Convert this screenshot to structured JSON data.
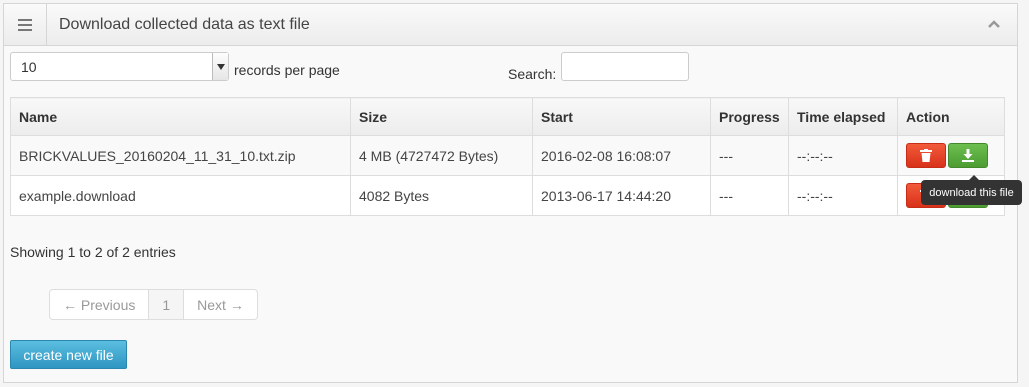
{
  "widget": {
    "title": "Download collected data as text file"
  },
  "controls": {
    "length_value": "10",
    "records_label": "records per page",
    "search_label": "Search:",
    "search_value": ""
  },
  "table": {
    "headers": [
      "Name",
      "Size",
      "Start",
      "Progress",
      "Time elapsed",
      "Action"
    ],
    "rows": [
      {
        "name": "BRICKVALUES_20160204_11_31_10.txt.zip",
        "size": "4 MB (4727472 Bytes)",
        "start": "2016-02-08 16:08:07",
        "progress": "---",
        "elapsed": "--:--:--"
      },
      {
        "name": "example.download",
        "size": "4082 Bytes",
        "start": "2013-06-17 14:44:20",
        "progress": "---",
        "elapsed": "--:--:--"
      }
    ]
  },
  "tooltip": "download this file",
  "info": "Showing 1 to 2 of 2 entries",
  "pagination": {
    "previous": "← Previous",
    "current": "1",
    "next": "Next →"
  },
  "create_button": "create new file",
  "colors": {
    "delete": "#d8321a",
    "download": "#4c9c32",
    "create": "#2f96c2"
  },
  "icons": {
    "menu": "list-icon",
    "collapse": "chevron-up-icon",
    "delete": "trash-icon",
    "download": "download-icon"
  }
}
